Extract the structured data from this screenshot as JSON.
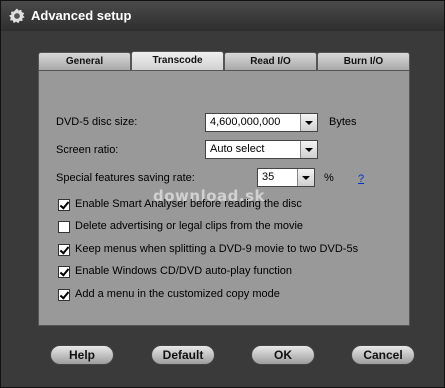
{
  "window": {
    "title": "Advanced setup"
  },
  "tabs": [
    {
      "label": "General",
      "active": false
    },
    {
      "label": "Transcode",
      "active": true
    },
    {
      "label": "Read I/O",
      "active": false
    },
    {
      "label": "Burn I/O",
      "active": false
    }
  ],
  "form": {
    "disc_size": {
      "label": "DVD-5 disc size:",
      "value": "4,600,000,000",
      "unit": "Bytes"
    },
    "screen_ratio": {
      "label": "Screen ratio:",
      "value": "Auto select"
    },
    "special_saving": {
      "label": "Special features saving rate:",
      "value": "35",
      "unit": "%",
      "help": "?"
    }
  },
  "options": [
    {
      "label": "Enable Smart Analyser before reading the disc",
      "checked": true
    },
    {
      "label": "Delete advertising or legal clips from the movie",
      "checked": false
    },
    {
      "label": "Keep menus when splitting a DVD-9 movie to two DVD-5s",
      "checked": true
    },
    {
      "label": "Enable Windows CD/DVD auto-play function",
      "checked": true
    },
    {
      "label": "Add a menu in the customized copy mode",
      "checked": true
    }
  ],
  "watermark": "download.sk",
  "buttons": {
    "help": "Help",
    "default": "Default",
    "ok": "OK",
    "cancel": "Cancel"
  },
  "colors": {
    "panel": "#999999",
    "frame": "#3a3a3a",
    "link": "#0033cc"
  },
  "icons": {
    "title": "gear-icon"
  }
}
